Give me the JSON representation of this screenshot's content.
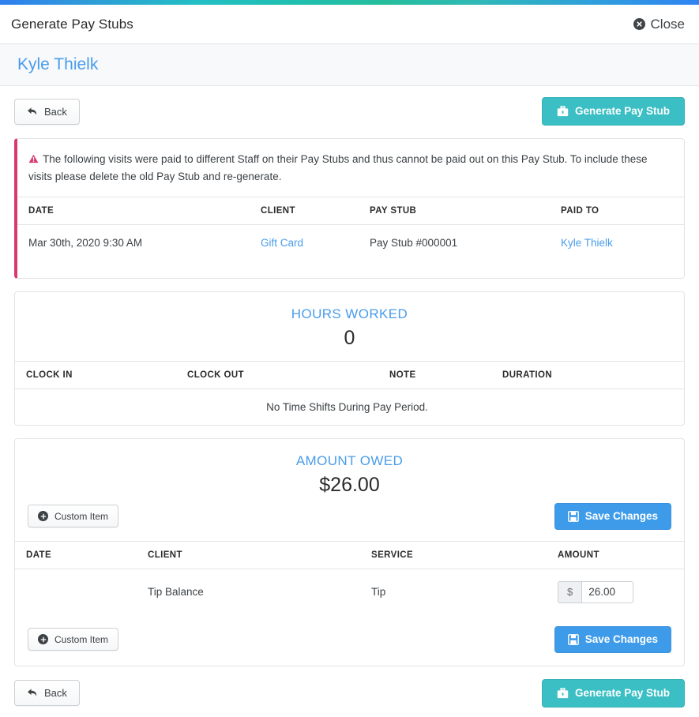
{
  "theme": {
    "accent_blue": "#4a9cea",
    "accent_teal": "#3bbfc4",
    "alert_pink": "#d93a6d",
    "button_blue": "#3e9be9"
  },
  "header": {
    "title": "Generate Pay Stubs",
    "close_label": "Close",
    "close_icon": "close-circle-icon"
  },
  "staff": {
    "name": "Kyle Thielk"
  },
  "toolbar": {
    "back_label": "Back",
    "back_icon": "reply-arrow-icon",
    "generate_label": "Generate Pay Stub",
    "generate_icon": "briefcase-icon"
  },
  "alert": {
    "icon": "warning-triangle-icon",
    "message": "The following visits were paid to different Staff on their Pay Stubs and thus cannot be paid out on this Pay Stub. To include these visits please delete the old Pay Stub and re-generate.",
    "table": {
      "columns": [
        "DATE",
        "CLIENT",
        "PAY STUB",
        "PAID TO"
      ],
      "rows": [
        {
          "date": "Mar 30th, 2020 9:30 AM",
          "client": "Gift Card",
          "pay_stub": "Pay Stub #000001",
          "paid_to": "Kyle Thielk"
        }
      ]
    }
  },
  "hours_worked": {
    "label": "HOURS WORKED",
    "value": "0",
    "columns": [
      "CLOCK IN",
      "CLOCK OUT",
      "NOTE",
      "DURATION"
    ],
    "empty_message": "No Time Shifts During Pay Period."
  },
  "amount_owed": {
    "label": "AMOUNT OWED",
    "value": "$26.00",
    "custom_item_label": "Custom Item",
    "custom_item_icon": "plus-circle-icon",
    "save_changes_label": "Save Changes",
    "save_changes_icon": "floppy-disk-icon",
    "columns": [
      "DATE",
      "CLIENT",
      "SERVICE",
      "AMOUNT"
    ],
    "rows": [
      {
        "date": "",
        "client": "Tip Balance",
        "service": "Tip",
        "currency_symbol": "$",
        "amount": "26.00"
      }
    ]
  }
}
